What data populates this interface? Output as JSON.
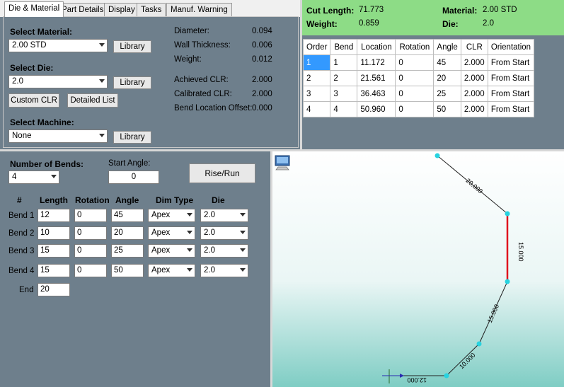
{
  "tabs": [
    {
      "label": "Die & Material"
    },
    {
      "label": "Part Details"
    },
    {
      "label": "Display"
    },
    {
      "label": "Tasks"
    },
    {
      "label": "Manuf. Warning"
    }
  ],
  "material_panel": {
    "select_material_label": "Select Material:",
    "material_value": "2.00 STD",
    "library_label": "Library",
    "select_die_label": "Select Die:",
    "die_value": "2.0",
    "custom_clr_label": "Custom CLR",
    "detailed_list_label": "Detailed List",
    "select_machine_label": "Select Machine:",
    "machine_value": "None"
  },
  "properties": [
    {
      "label": "Diameter:",
      "value": "0.094"
    },
    {
      "label": "Wall Thickness:",
      "value": "0.006"
    },
    {
      "label": "Weight:",
      "value": "0.012"
    },
    {
      "label": "Achieved CLR:",
      "value": "2.000"
    },
    {
      "label": "Calibrated CLR:",
      "value": "2.000"
    },
    {
      "label": "Bend Location Offset:",
      "value": "0.000"
    }
  ],
  "summary": {
    "cut_length_label": "Cut Length:",
    "cut_length_value": "71.773",
    "weight_label": "Weight:",
    "weight_value": "0.859",
    "material_label": "Material:",
    "material_value": "2.00 STD",
    "die_label": "Die:",
    "die_value": "2.0",
    "bg_color": "#8ddc86"
  },
  "bend_table": {
    "headers": [
      "Order",
      "Bend",
      "Location",
      "Rotation",
      "Angle",
      "CLR",
      "Orientation"
    ],
    "rows": [
      [
        "1",
        "1",
        "11.172",
        "0",
        "45",
        "2.000",
        "From Start"
      ],
      [
        "2",
        "2",
        "21.561",
        "0",
        "20",
        "2.000",
        "From Start"
      ],
      [
        "3",
        "3",
        "36.463",
        "0",
        "25",
        "2.000",
        "From Start"
      ],
      [
        "4",
        "4",
        "50.960",
        "0",
        "50",
        "2.000",
        "From Start"
      ]
    ]
  },
  "bends_panel": {
    "number_of_bends_label": "Number of Bends:",
    "number_of_bends_value": "4",
    "start_angle_label": "Start Angle:",
    "start_angle_value": "0",
    "rise_run_label": "Rise/Run",
    "col_headers": [
      "#",
      "Length",
      "Rotation",
      "Angle",
      "Dim Type",
      "Die"
    ],
    "rows": [
      {
        "label": "Bend 1",
        "length": "12",
        "rotation": "0",
        "angle": "45",
        "dim_type": "Apex",
        "die": "2.0"
      },
      {
        "label": "Bend 2",
        "length": "10",
        "rotation": "0",
        "angle": "20",
        "dim_type": "Apex",
        "die": "2.0"
      },
      {
        "label": "Bend 3",
        "length": "15",
        "rotation": "0",
        "angle": "25",
        "dim_type": "Apex",
        "die": "2.0"
      },
      {
        "label": "Bend 4",
        "length": "15",
        "rotation": "0",
        "angle": "50",
        "dim_type": "Apex",
        "die": "2.0"
      }
    ],
    "end_label": "End",
    "end_value": "20"
  },
  "viewport": {
    "dimension_labels": [
      "20.000",
      "15.000",
      "15.000",
      "10.000",
      "12.000"
    ],
    "node_color": "#27d3e0",
    "highlight_color": "#e0141e",
    "icon": "monitor-icon"
  }
}
